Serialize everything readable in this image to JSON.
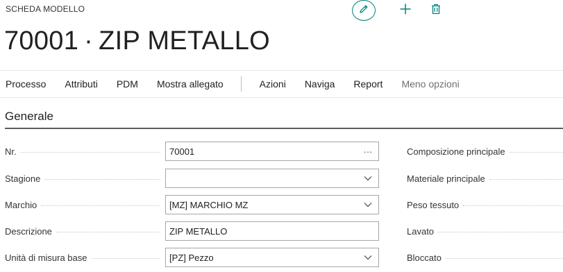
{
  "page": {
    "caption": "SCHEDA MODELLO",
    "record_no": "70001",
    "title_sep": "·",
    "record_name": "ZIP METALLO",
    "icons": {
      "edit": "pencil-icon",
      "new": "plus-icon",
      "delete": "trash-icon"
    },
    "accent_color": "#00807f"
  },
  "actionbar": {
    "items": [
      "Processo",
      "Attributi",
      "PDM",
      "Mostra allegato",
      "Azioni",
      "Naviga",
      "Report",
      "Meno opzioni"
    ]
  },
  "section": {
    "title": "Generale"
  },
  "fields_left": [
    {
      "label": "Nr.",
      "value": "70001",
      "trailing": "ellipsis",
      "trailing_text": "···"
    },
    {
      "label": "Stagione",
      "value": "",
      "trailing": "chevron-down"
    },
    {
      "label": "Marchio",
      "value": "[MZ] MARCHIO MZ",
      "trailing": "chevron-down"
    },
    {
      "label": "Descrizione",
      "value": "ZIP METALLO",
      "trailing": "none"
    },
    {
      "label": "Unità di misura base",
      "value": "[PZ] Pezzo",
      "trailing": "chevron-down"
    }
  ],
  "fields_right": [
    {
      "label": "Composizione principale"
    },
    {
      "label": "Materiale principale"
    },
    {
      "label": "Peso tessuto"
    },
    {
      "label": "Lavato"
    },
    {
      "label": "Bloccato"
    }
  ]
}
